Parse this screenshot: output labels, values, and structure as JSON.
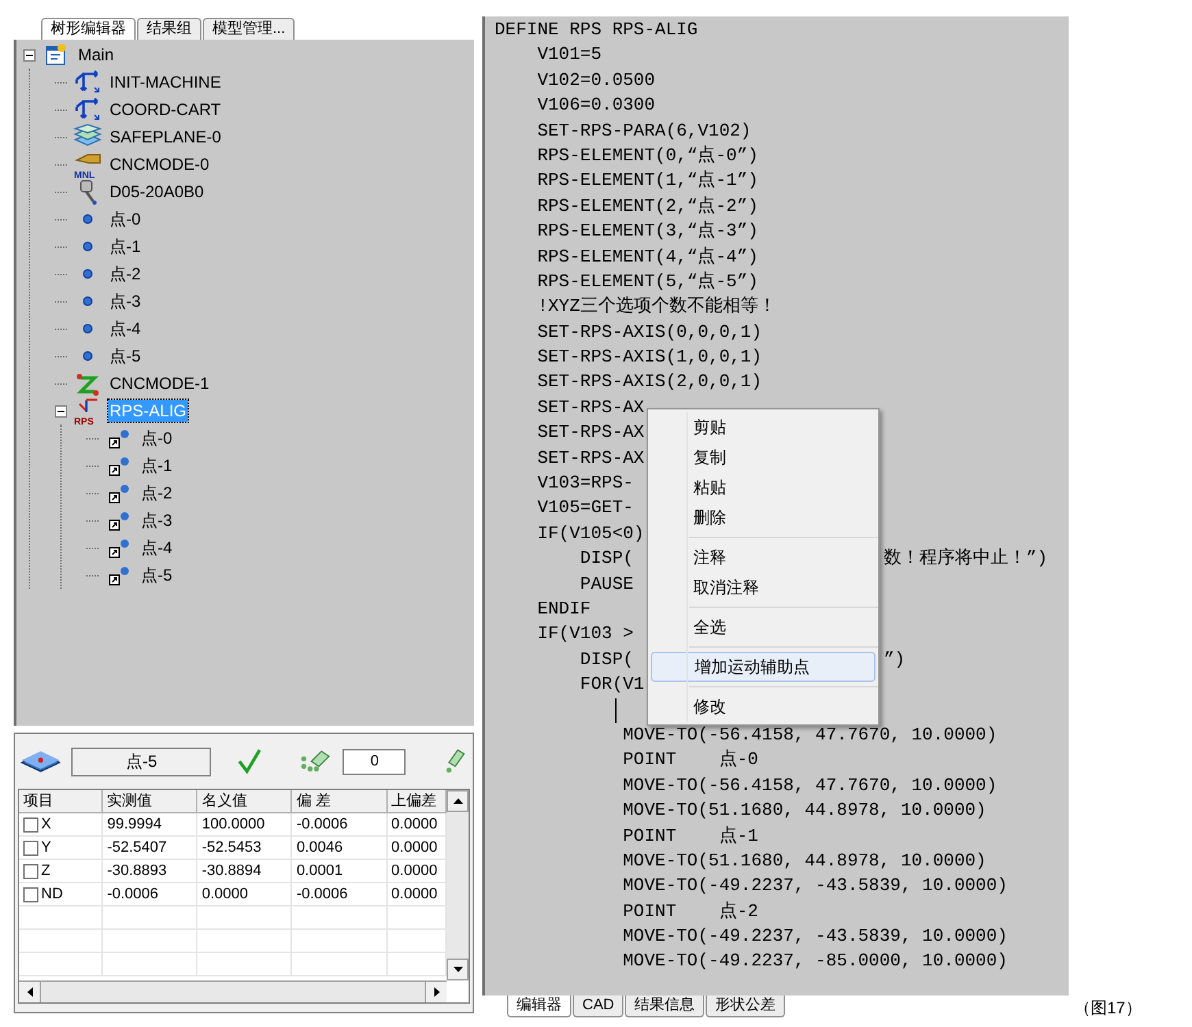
{
  "left_tabs": [
    {
      "label": "树形编辑器",
      "selected": true
    },
    {
      "label": "结果组",
      "selected": false
    },
    {
      "label": "模型管理...",
      "selected": false
    }
  ],
  "tree": [
    {
      "label": "Main",
      "kind": "program",
      "expanded": true,
      "selected": false,
      "children": [
        {
          "label": "INIT-MACHINE",
          "kind": "axes",
          "selected": false
        },
        {
          "label": "COORD-CART",
          "kind": "axes",
          "selected": false
        },
        {
          "label": "SAFEPLANE-0",
          "kind": "plane",
          "selected": false
        },
        {
          "label": "CNCMODE-0",
          "kind": "manual",
          "badge": "MNL",
          "selected": false
        },
        {
          "label": "D05-20A0B0",
          "kind": "probe",
          "selected": false
        },
        {
          "label": "点-0",
          "kind": "point",
          "selected": false
        },
        {
          "label": "点-1",
          "kind": "point",
          "selected": false
        },
        {
          "label": "点-2",
          "kind": "point",
          "selected": false
        },
        {
          "label": "点-3",
          "kind": "point",
          "selected": false
        },
        {
          "label": "点-4",
          "kind": "point",
          "selected": false
        },
        {
          "label": "点-5",
          "kind": "point",
          "selected": false
        },
        {
          "label": "CNCMODE-1",
          "kind": "cnc",
          "selected": false
        },
        {
          "label": "RPS-ALIG",
          "kind": "rps",
          "badge": "RPS",
          "expanded": true,
          "selected": true,
          "children": [
            {
              "label": "点-0",
              "kind": "linkpoint",
              "selected": false
            },
            {
              "label": "点-1",
              "kind": "linkpoint",
              "selected": false
            },
            {
              "label": "点-2",
              "kind": "linkpoint",
              "selected": false
            },
            {
              "label": "点-3",
              "kind": "linkpoint",
              "selected": false
            },
            {
              "label": "点-4",
              "kind": "linkpoint",
              "selected": false
            },
            {
              "label": "点-5",
              "kind": "linkpoint",
              "selected": false
            }
          ]
        }
      ]
    }
  ],
  "feature_bar": {
    "name_field": "点-5",
    "count_field": "0"
  },
  "table": {
    "columns": [
      "项目",
      "实测值",
      "名义值",
      "偏 差",
      "上偏差"
    ],
    "rows": [
      {
        "checked": false,
        "cells": [
          "X",
          "99.9994",
          "100.0000",
          "-0.0006",
          "0.0000"
        ]
      },
      {
        "checked": false,
        "cells": [
          "Y",
          "-52.5407",
          "-52.5453",
          "0.0046",
          "0.0000"
        ]
      },
      {
        "checked": false,
        "cells": [
          "Z",
          "-30.8893",
          "-30.8894",
          "0.0001",
          "0.0000"
        ]
      },
      {
        "checked": false,
        "cells": [
          "ND",
          "-0.0006",
          "0.0000",
          "-0.0006",
          "0.0000"
        ]
      }
    ]
  },
  "code": [
    {
      "kind": "code",
      "text": "DEFINE RPS RPS-ALIG"
    },
    {
      "kind": "code",
      "text": "    V101=5"
    },
    {
      "kind": "code",
      "text": "    V102=0.0500"
    },
    {
      "kind": "code",
      "text": "    V106=0.0300"
    },
    {
      "kind": "code",
      "text": "    SET-RPS-PARA(6,V102)"
    },
    {
      "kind": "code",
      "text": "    RPS-ELEMENT(0,“点-0”)"
    },
    {
      "kind": "code",
      "text": "    RPS-ELEMENT(1,“点-1”)"
    },
    {
      "kind": "code",
      "text": "    RPS-ELEMENT(2,“点-2”)"
    },
    {
      "kind": "code",
      "text": "    RPS-ELEMENT(3,“点-3”)"
    },
    {
      "kind": "code",
      "text": "    RPS-ELEMENT(4,“点-4”)"
    },
    {
      "kind": "code",
      "text": "    RPS-ELEMENT(5,“点-5”)"
    },
    {
      "kind": "code",
      "text": "    !XYZ三个选项个数不能相等！"
    },
    {
      "kind": "code",
      "text": "    SET-RPS-AXIS(0,0,0,1)"
    },
    {
      "kind": "code",
      "text": "    SET-RPS-AXIS(1,0,0,1)"
    },
    {
      "kind": "code",
      "text": "    SET-RPS-AXIS(2,0,0,1)"
    },
    {
      "kind": "code",
      "text": "    SET-RPS-AX"
    },
    {
      "kind": "code",
      "text": "    SET-RPS-AX"
    },
    {
      "kind": "code",
      "text": "    SET-RPS-AX"
    },
    {
      "kind": "code",
      "text": "    V103=RPS-"
    },
    {
      "kind": "code",
      "text": "    V105=GET-"
    },
    {
      "kind": "code",
      "text": "    IF(V105<0)"
    },
    {
      "kind": "code",
      "text": "        DISP(",
      "tail": "数！程序将中止！”)"
    },
    {
      "kind": "code",
      "text": "        PAUSE"
    },
    {
      "kind": "code",
      "text": "    ENDIF"
    },
    {
      "kind": "code",
      "text": "    IF(V103 >"
    },
    {
      "kind": "code",
      "text": "        DISP(",
      "tail": "”)"
    },
    {
      "kind": "code",
      "text": "        FOR(V1"
    },
    {
      "kind": "caret"
    },
    {
      "kind": "code",
      "text": "            MOVE-TO(-56.4158, 47.7670, 10.0000)"
    },
    {
      "kind": "code",
      "text": "            POINT    点-0"
    },
    {
      "kind": "code",
      "text": "            MOVE-TO(-56.4158, 47.7670, 10.0000)"
    },
    {
      "kind": "code",
      "text": "            MOVE-TO(51.1680, 44.8978, 10.0000)"
    },
    {
      "kind": "code",
      "text": "            POINT    点-1"
    },
    {
      "kind": "code",
      "text": "            MOVE-TO(51.1680, 44.8978, 10.0000)"
    },
    {
      "kind": "code",
      "text": "            MOVE-TO(-49.2237, -43.5839, 10.0000)"
    },
    {
      "kind": "code",
      "text": "            POINT    点-2"
    },
    {
      "kind": "code",
      "text": "            MOVE-TO(-49.2237, -43.5839, 10.0000)"
    },
    {
      "kind": "code",
      "text": "            MOVE-TO(-49.2237, -85.0000, 10.0000)"
    }
  ],
  "context_menu": [
    [
      {
        "label": "剪贴",
        "selected": false
      },
      {
        "label": "复制",
        "selected": false
      },
      {
        "label": "粘贴",
        "selected": false
      },
      {
        "label": "删除",
        "selected": false
      }
    ],
    [
      {
        "label": "注释",
        "selected": false
      },
      {
        "label": "取消注释",
        "selected": false
      }
    ],
    [
      {
        "label": "全选",
        "selected": false
      }
    ],
    [
      {
        "label": "增加运动辅助点",
        "selected": true
      }
    ],
    [
      {
        "label": "修改",
        "selected": false
      }
    ]
  ],
  "bottom_tabs": [
    {
      "label": "编辑器",
      "selected": true
    },
    {
      "label": "CAD",
      "selected": false
    },
    {
      "label": "结果信息",
      "selected": false
    },
    {
      "label": "形状公差",
      "selected": false
    }
  ],
  "caption": "（图17）"
}
